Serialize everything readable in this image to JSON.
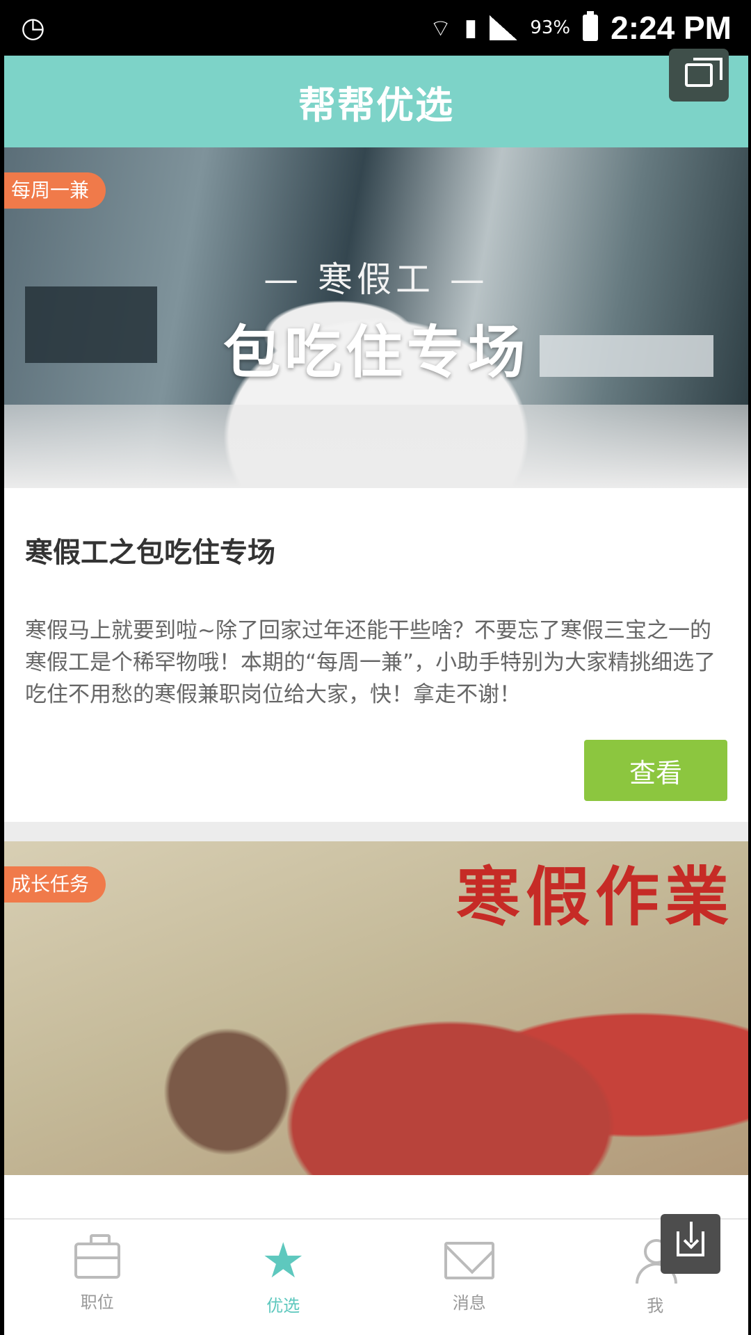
{
  "status_bar": {
    "time": "2:24 PM",
    "battery_percent": "93%",
    "icons": [
      "clock-icon",
      "wifi-icon",
      "sim-icon",
      "signal-icon",
      "battery-icon"
    ]
  },
  "header": {
    "title": "帮帮优选"
  },
  "cards": [
    {
      "tag": "每周一兼",
      "banner_subtitle": "— 寒假工 —",
      "banner_title": "包吃住专场",
      "title": "寒假工之包吃住专场",
      "description": "寒假马上就要到啦~除了回家过年还能干些啥？不要忘了寒假三宝之一的寒假工是个稀罕物哦！本期的“每周一兼”，小助手特别为大家精挑细选了吃住不用愁的寒假兼职岗位给大家，快！拿走不谢！",
      "button_label": "查看"
    },
    {
      "tag": "成长任务",
      "poster_title": "寒假作業"
    }
  ],
  "bottom_nav": [
    {
      "label": "职位",
      "icon": "briefcase-icon",
      "active": false
    },
    {
      "label": "优选",
      "icon": "star-icon",
      "active": true
    },
    {
      "label": "消息",
      "icon": "mail-icon",
      "active": false
    },
    {
      "label": "我",
      "icon": "user-icon",
      "active": false
    }
  ],
  "colors": {
    "header": "#7dd3c8",
    "accent": "#5ec8be",
    "button": "#8cc63f",
    "tag": "#f07a4a"
  }
}
